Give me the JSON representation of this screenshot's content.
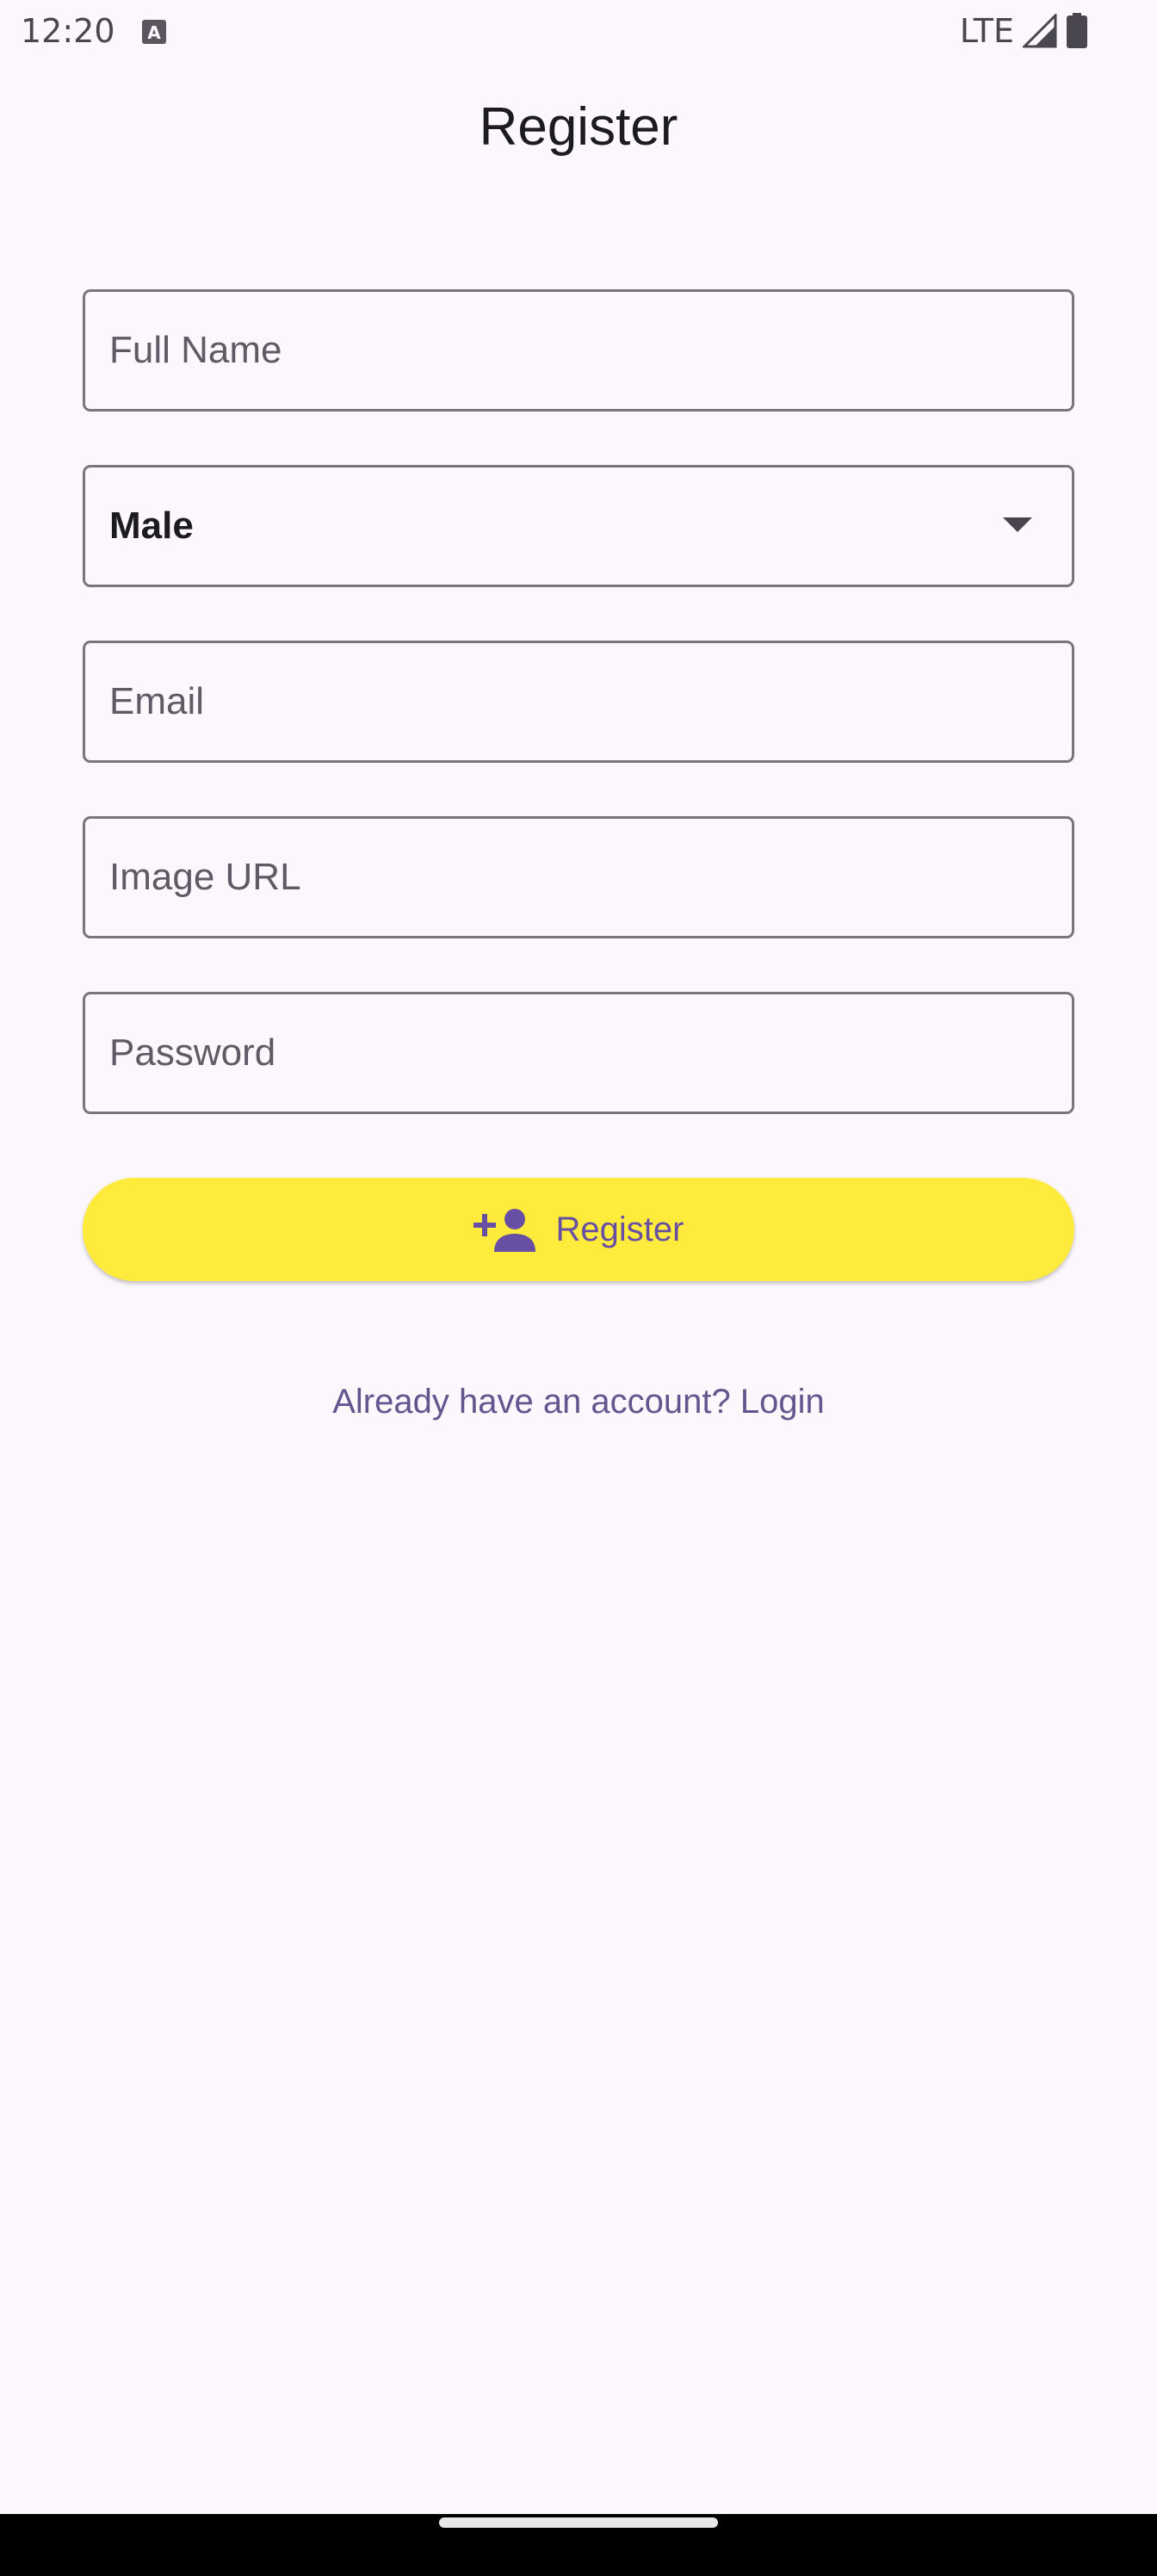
{
  "status_bar": {
    "time": "12:20",
    "network": "LTE",
    "notification_icon": "text-a-icon",
    "signal_icon": "cell-signal-icon",
    "battery_icon": "battery-icon"
  },
  "page": {
    "title": "Register"
  },
  "form": {
    "full_name": {
      "placeholder": "Full Name",
      "value": ""
    },
    "gender": {
      "selected": "Male"
    },
    "email": {
      "placeholder": "Email",
      "value": ""
    },
    "image_url": {
      "placeholder": "Image URL",
      "value": ""
    },
    "password": {
      "placeholder": "Password",
      "value": ""
    }
  },
  "actions": {
    "register_label": "Register",
    "register_icon": "person-add-icon",
    "login_link": "Already have an account? Login"
  },
  "colors": {
    "background": "#FCF7FC",
    "button": "#FFEB3B",
    "accent": "#6750A4",
    "outline": "#79747E"
  }
}
